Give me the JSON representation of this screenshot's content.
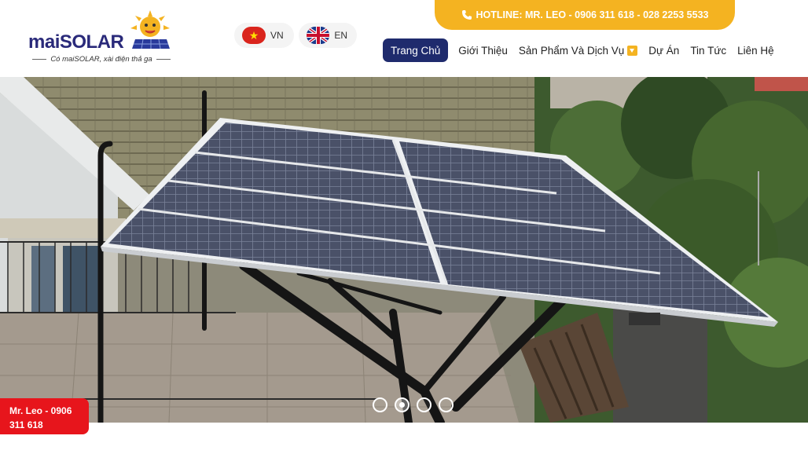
{
  "brand": {
    "name_part1": "mai",
    "name_part2": "SOLAR",
    "tagline": "Có maiSOLAR, xài điện thả ga"
  },
  "languages": [
    {
      "code": "VN",
      "flag": "vn-flag-icon"
    },
    {
      "code": "EN",
      "flag": "uk-flag-icon"
    }
  ],
  "hotline": {
    "text": "HOTLINE: MR. LEO - 0906 311 618 - 028 2253 5533",
    "icon": "phone-icon"
  },
  "nav": {
    "items": [
      {
        "label": "Trang Chủ",
        "active": true
      },
      {
        "label": "Giới Thiệu"
      },
      {
        "label": "Sản Phẩm Và Dịch Vụ",
        "has_dropdown": true
      },
      {
        "label": "Dự Án"
      },
      {
        "label": "Tin Tức"
      },
      {
        "label": "Liên Hệ"
      }
    ]
  },
  "slider": {
    "slide_count": 4,
    "active_index": 1
  },
  "contact_badge": {
    "line1": "Mr. Leo - 0906",
    "line2": "311 618"
  },
  "colors": {
    "accent": "#f4b321",
    "nav_active": "#1f2b6d",
    "badge": "#e7151c"
  }
}
